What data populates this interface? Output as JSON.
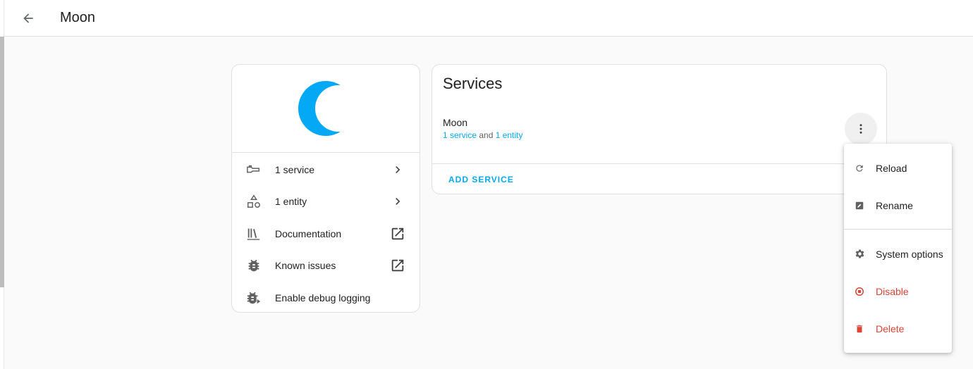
{
  "header": {
    "title": "Moon"
  },
  "integration_card": {
    "items": [
      {
        "label": "1 service",
        "icon": "service-icon",
        "trail_icon": "chevron-right-icon"
      },
      {
        "label": "1 entity",
        "icon": "shapes-icon",
        "trail_icon": "chevron-right-icon"
      },
      {
        "label": "Documentation",
        "icon": "book-icon",
        "trail_icon": "open-in-new-icon"
      },
      {
        "label": "Known issues",
        "icon": "bug-icon",
        "trail_icon": "open-in-new-icon"
      },
      {
        "label": "Enable debug logging",
        "icon": "bug-play-icon"
      }
    ]
  },
  "services_card": {
    "title": "Services",
    "entry": {
      "name": "Moon",
      "services_link": "1 service",
      "conjunction": "and",
      "entities_link": "1 entity"
    },
    "add_label": "ADD SERVICE"
  },
  "menu": {
    "items": [
      {
        "label": "Reload",
        "icon": "reload-icon"
      },
      {
        "label": "Rename",
        "icon": "rename-icon"
      },
      {
        "label": "System options",
        "icon": "gear-icon"
      },
      {
        "label": "Disable",
        "icon": "disable-icon",
        "danger": true
      },
      {
        "label": "Delete",
        "icon": "trash-icon",
        "danger": true
      }
    ]
  },
  "colors": {
    "accent": "#03a9f4",
    "danger": "#db4437",
    "text": "#212121",
    "background": "#fafafa"
  }
}
